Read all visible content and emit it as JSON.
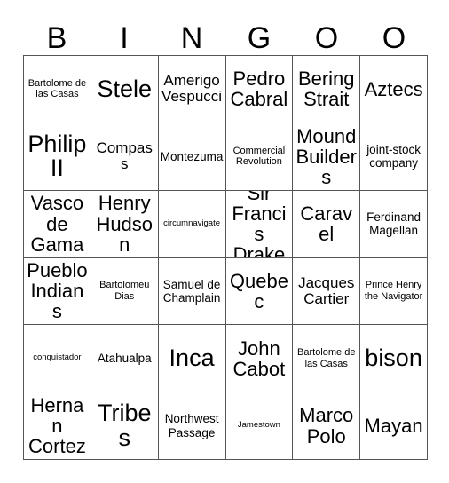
{
  "card": {
    "title_letters": [
      "B",
      "I",
      "N",
      "G",
      "O",
      "O"
    ],
    "columns": 6,
    "rows": 6,
    "colors": {
      "grid_line": "#555555",
      "text": "#000000",
      "background": "#ffffff"
    },
    "cells": [
      [
        {
          "text": "Bartolome de las Casas",
          "size": "xs"
        },
        {
          "text": "Stele",
          "size": "xl"
        },
        {
          "text": "Amerigo Vespucci",
          "size": "md"
        },
        {
          "text": "Pedro Cabral",
          "size": "lg"
        },
        {
          "text": "Bering Strait",
          "size": "lg"
        },
        {
          "text": "Aztecs",
          "size": "lg"
        }
      ],
      [
        {
          "text": "Philip II",
          "size": "xl"
        },
        {
          "text": "Compass",
          "size": "md"
        },
        {
          "text": "Montezuma",
          "size": "sm"
        },
        {
          "text": "Commercial Revolution",
          "size": "xs"
        },
        {
          "text": "Mound Builders",
          "size": "lg"
        },
        {
          "text": "joint-stock company",
          "size": "sm"
        }
      ],
      [
        {
          "text": "Vasco de Gama",
          "size": "lg"
        },
        {
          "text": "Henry Hudson",
          "size": "lg"
        },
        {
          "text": "circumnavigate",
          "size": "xxs"
        },
        {
          "text": "Sir Francis Drake",
          "size": "lg"
        },
        {
          "text": "Caravel",
          "size": "lg"
        },
        {
          "text": "Ferdinand Magellan",
          "size": "sm"
        }
      ],
      [
        {
          "text": "Pueblo Indians",
          "size": "lg"
        },
        {
          "text": "Bartolomeu Dias",
          "size": "xs"
        },
        {
          "text": "Samuel de Champlain",
          "size": "sm"
        },
        {
          "text": "Quebec",
          "size": "lg"
        },
        {
          "text": "Jacques Cartier",
          "size": "md"
        },
        {
          "text": "Prince Henry the Navigator",
          "size": "xs"
        }
      ],
      [
        {
          "text": "conquistador",
          "size": "xxs"
        },
        {
          "text": "Atahualpa",
          "size": "sm"
        },
        {
          "text": "Inca",
          "size": "xl"
        },
        {
          "text": "John Cabot",
          "size": "lg"
        },
        {
          "text": "Bartolome de las Casas",
          "size": "xs"
        },
        {
          "text": "bison",
          "size": "xl"
        }
      ],
      [
        {
          "text": "Hernan Cortez",
          "size": "lg"
        },
        {
          "text": "Tribes",
          "size": "xl"
        },
        {
          "text": "Northwest Passage",
          "size": "sm"
        },
        {
          "text": "Jamestown",
          "size": "xxs"
        },
        {
          "text": "Marco Polo",
          "size": "lg"
        },
        {
          "text": "Mayan",
          "size": "lg"
        }
      ]
    ]
  }
}
